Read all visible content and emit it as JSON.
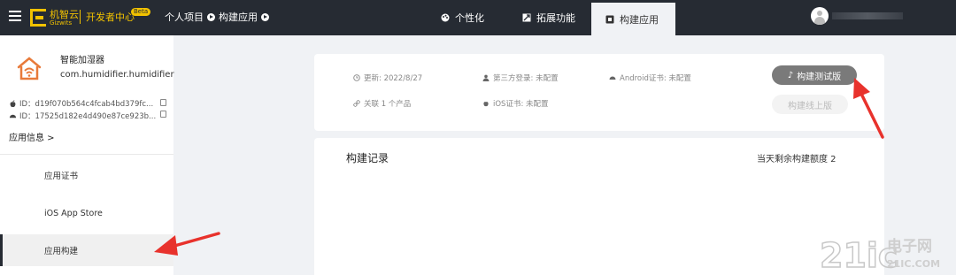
{
  "topbar": {
    "logo_cn": "机智云",
    "logo_en": "Gizwits",
    "dev_center": "开发者中心",
    "beta_badge": "Beta",
    "breadcrumbs": [
      "个人项目",
      "构建应用"
    ],
    "tabs": [
      {
        "label": "个性化",
        "icon": "palette-icon",
        "active": false
      },
      {
        "label": "拓展功能",
        "icon": "extension-icon",
        "active": false
      },
      {
        "label": "构建应用",
        "icon": "build-icon",
        "active": true
      }
    ],
    "user_name_separator": ":"
  },
  "sidebar": {
    "app_name": "智能加湿器",
    "app_bundle": "com.humidifier.humidifier",
    "ios_id": "ID：d19f070b564c4fcab4bd379fc...",
    "android_id": "ID：17525d182e4d490e87ce923b...",
    "app_info_label": "应用信息 >",
    "items": [
      {
        "label": "应用证书",
        "active": false
      },
      {
        "label": "iOS App Store",
        "active": false
      },
      {
        "label": "应用构建",
        "active": true
      }
    ]
  },
  "build_info": {
    "updated": "更新: 2022/8/27",
    "third_party_login": "第三方登录: 未配置",
    "android_cert": "Android证书: 未配置",
    "linked_products": "关联 1 个产品",
    "ios_cert": "iOS证书: 未配置",
    "build_test_label": "构建测试版",
    "build_release_label": "构建线上版"
  },
  "records": {
    "title": "构建记录",
    "quota": "当天剩余构建额度 2"
  },
  "watermark": {
    "brand": "21ic",
    "name": "电子网",
    "domain": "21IC.COM"
  },
  "colors": {
    "topbar_bg": "#262b33",
    "brand_yellow": "#f2c200",
    "page_bg": "#f0f2f5",
    "arrow_red": "#e8322c"
  }
}
